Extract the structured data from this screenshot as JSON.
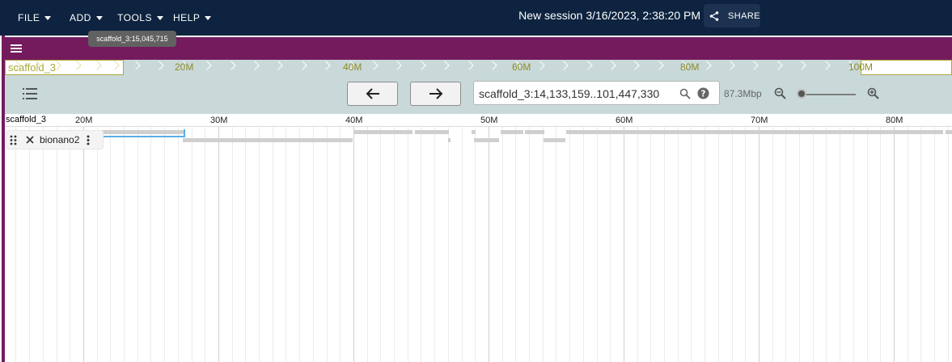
{
  "menubar": {
    "file": "FILE",
    "add": "ADD",
    "tools": "TOOLS",
    "help": "HELP",
    "session_title": "New session 3/16/2023, 2:38:20 PM",
    "share": "SHARE"
  },
  "tooltip": {
    "text": "scaffold_3:15,045,715"
  },
  "overview": {
    "chrom": "scaffold_3",
    "ticks": [
      "20M",
      "40M",
      "60M",
      "80M",
      "100M"
    ]
  },
  "controls": {
    "location": "scaffold_3:14,133,159..101,447,330",
    "bp_width": "87.3Mbp",
    "zoom_level": 0.05
  },
  "ruler": {
    "chrom": "scaffold_3",
    "ticks": [
      "20M",
      "30M",
      "40M",
      "50M",
      "60M",
      "70M",
      "80M"
    ]
  },
  "track": {
    "name": "bionano2"
  },
  "icons": {
    "menu": "hamburger-icon",
    "share": "share-icon",
    "back": "arrow-left-icon",
    "forward": "arrow-right-icon",
    "search": "search-icon",
    "help": "help-icon",
    "zoom_out": "zoom-out-icon",
    "zoom_in": "zoom-in-icon",
    "track_selector": "track-list-icon",
    "drag": "drag-handle-icon",
    "close": "close-icon",
    "more": "more-vert-icon"
  },
  "colors": {
    "topbar": "#0d233f",
    "view_header": "#741b5e",
    "overview_bg": "#c9d9d9",
    "feature": "#cfcfcf",
    "selection": "#5aaee6"
  }
}
